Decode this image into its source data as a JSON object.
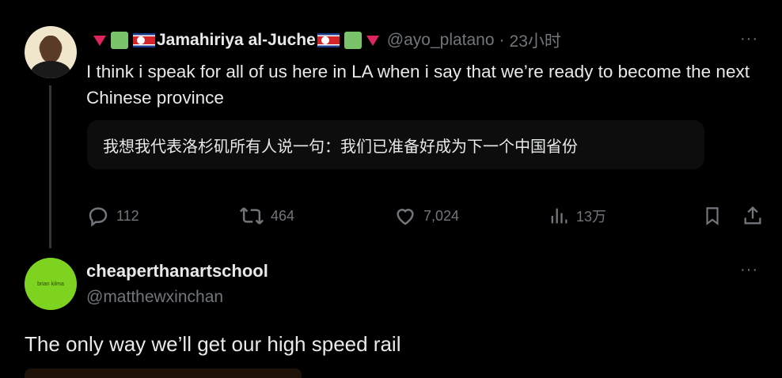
{
  "tweet": {
    "display_name": "Jamahiriya al-Juche",
    "handle": "@ayo_platano",
    "separator": "·",
    "time": "23小时",
    "more": "···",
    "text": "I think i speak for all of us here in LA when i say that we’re ready to become the next Chinese province",
    "translation": "我想我代表洛杉矶所有人说一句：我们已准备好成为下一个中国省份",
    "stats": {
      "replies": "112",
      "retweets": "464",
      "likes": "7,024",
      "views": "13万"
    },
    "accent_colors": {
      "triangle": "#e0245e",
      "square": "#7ac36a"
    }
  },
  "reply": {
    "display_name": "cheaperthanartschool",
    "handle": "@matthewxinchan",
    "more": "···",
    "avatar_text": "brian kilma",
    "avatar_color": "#7ed321",
    "text": "The only way we’ll get our high speed rail"
  }
}
